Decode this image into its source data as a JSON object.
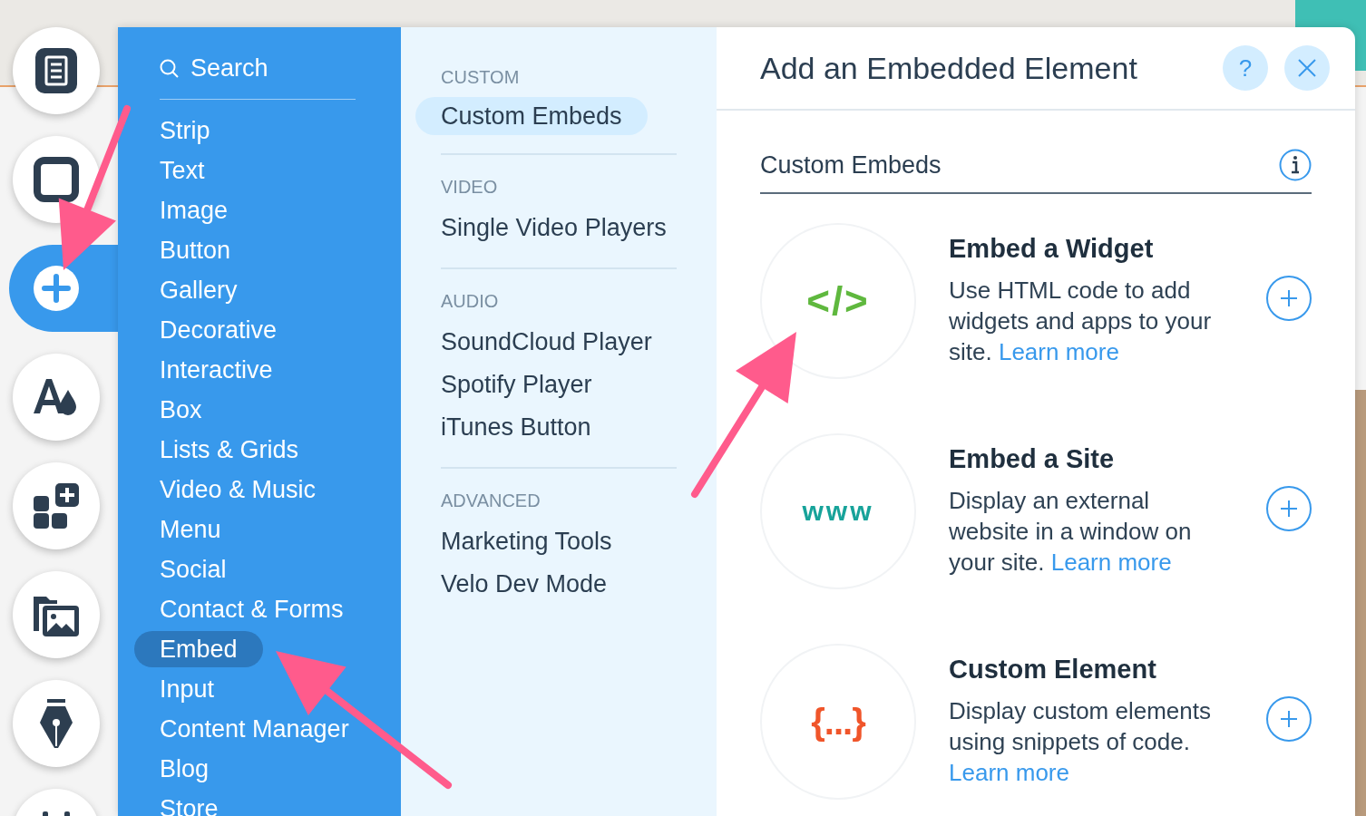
{
  "toolbar": [
    {
      "kind": "pages",
      "selected": false
    },
    {
      "kind": "background",
      "selected": false
    },
    {
      "kind": "add",
      "selected": true
    },
    {
      "kind": "design",
      "selected": false
    },
    {
      "kind": "apps",
      "selected": false
    },
    {
      "kind": "media",
      "selected": false
    },
    {
      "kind": "blog",
      "selected": false
    },
    {
      "kind": "calendar",
      "selected": false
    }
  ],
  "add_panel": {
    "search": {
      "placeholder": "Search"
    },
    "categories": [
      {
        "label": "Strip",
        "selected": false
      },
      {
        "label": "Text",
        "selected": false
      },
      {
        "label": "Image",
        "selected": false
      },
      {
        "label": "Button",
        "selected": false
      },
      {
        "label": "Gallery",
        "selected": false
      },
      {
        "label": "Decorative",
        "selected": false
      },
      {
        "label": "Interactive",
        "selected": false
      },
      {
        "label": "Box",
        "selected": false
      },
      {
        "label": "Lists & Grids",
        "selected": false
      },
      {
        "label": "Video & Music",
        "selected": false
      },
      {
        "label": "Menu",
        "selected": false
      },
      {
        "label": "Social",
        "selected": false
      },
      {
        "label": "Contact & Forms",
        "selected": false
      },
      {
        "label": "Embed",
        "selected": true
      },
      {
        "label": "Input",
        "selected": false
      },
      {
        "label": "Content Manager",
        "selected": false
      },
      {
        "label": "Blog",
        "selected": false
      },
      {
        "label": "Store",
        "selected": false
      }
    ],
    "sections": [
      {
        "heading": "CUSTOM",
        "items": [
          {
            "label": "Custom Embeds",
            "selected": true
          }
        ]
      },
      {
        "heading": "VIDEO",
        "items": [
          {
            "label": "Single Video Players",
            "selected": false
          }
        ]
      },
      {
        "heading": "AUDIO",
        "items": [
          {
            "label": "SoundCloud Player",
            "selected": false
          },
          {
            "label": "Spotify Player",
            "selected": false
          },
          {
            "label": "iTunes Button",
            "selected": false
          }
        ]
      },
      {
        "heading": "ADVANCED",
        "items": [
          {
            "label": "Marketing Tools",
            "selected": false
          },
          {
            "label": "Velo Dev Mode",
            "selected": false
          }
        ]
      }
    ],
    "title": "Add an Embedded Element",
    "help_button": "?",
    "section_title": "Custom Embeds",
    "elements": [
      {
        "kind": "code",
        "icon_text": "</>",
        "color": "#5fb83e",
        "title": "Embed a Widget",
        "description": "Use HTML code to add widgets and apps to your site.",
        "link": "Learn more"
      },
      {
        "kind": "www",
        "icon_text": "www",
        "color": "#17a39a",
        "title": "Embed a Site",
        "description": "Display an external website in a window on your site.",
        "link": "Learn more"
      },
      {
        "kind": "braces",
        "icon_text": "{...}",
        "color": "#f0552a",
        "title": "Custom Element",
        "description": "Display custom elements using snippets of code.",
        "link": "Learn more"
      }
    ]
  }
}
